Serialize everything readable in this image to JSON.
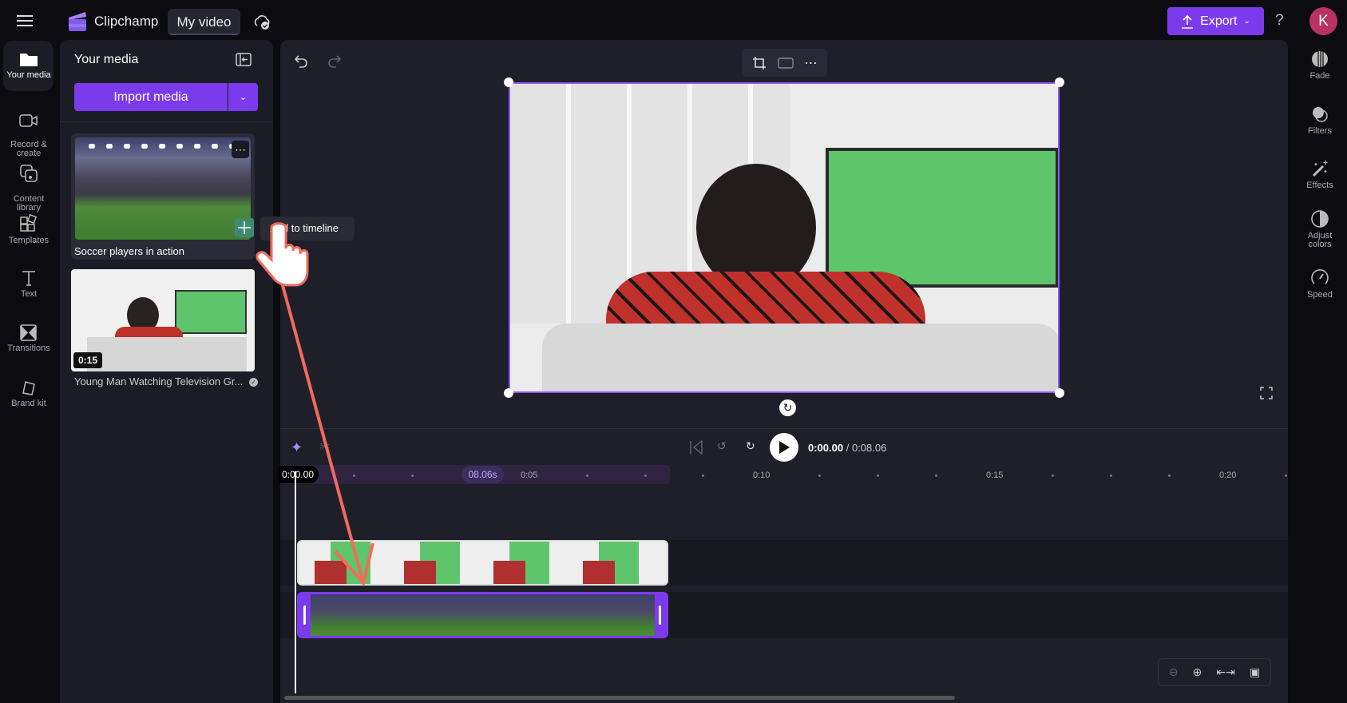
{
  "header": {
    "app_name": "Clipchamp",
    "project_title": "My video",
    "export_label": "Export",
    "help": "?",
    "avatar_initial": "K"
  },
  "left_rail": [
    {
      "label": "Your media",
      "icon": "folder-icon"
    },
    {
      "label": "Record &\ncreate",
      "icon": "camera-icon"
    },
    {
      "label": "Content\nlibrary",
      "icon": "library-icon"
    },
    {
      "label": "Templates",
      "icon": "templates-icon"
    },
    {
      "label": "Text",
      "icon": "text-icon"
    },
    {
      "label": "Transitions",
      "icon": "transitions-icon"
    },
    {
      "label": "Brand kit",
      "icon": "brand-kit-icon"
    }
  ],
  "media_panel": {
    "title": "Your media",
    "import_label": "Import media",
    "items": [
      {
        "title": "Soccer players in action",
        "tooltip": "Add to timeline"
      },
      {
        "title": "Young Man Watching Television Gr...",
        "duration": "0:15"
      }
    ]
  },
  "right_rail": [
    {
      "label": "Fade"
    },
    {
      "label": "Filters"
    },
    {
      "label": "Effects"
    },
    {
      "label": "Adjust\ncolors"
    },
    {
      "label": "Speed"
    }
  ],
  "playback": {
    "current": "0:00.00",
    "separator": "/",
    "total": "0:08.06"
  },
  "timeline": {
    "playhead": "0:00.00",
    "clip_duration": "08.06s",
    "ticks": [
      "0:05",
      "0:10",
      "0:15",
      "0:20"
    ]
  },
  "colors": {
    "accent": "#7c3aed",
    "avatar": "#b83262",
    "arrow": "#f26b5b"
  }
}
